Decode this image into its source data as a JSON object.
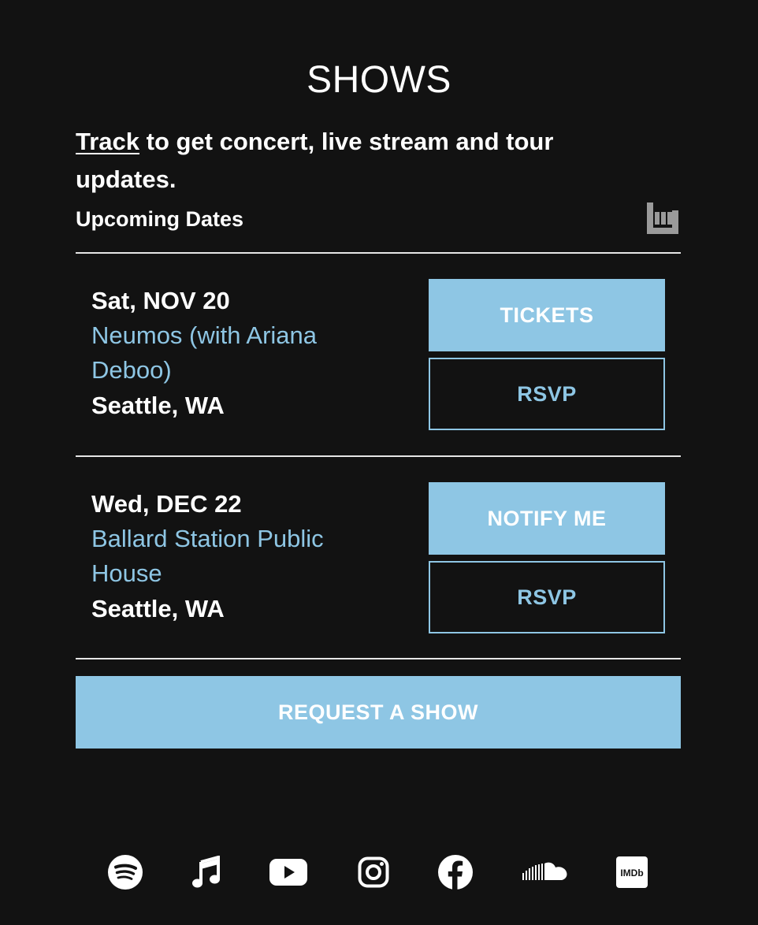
{
  "page": {
    "title": "SHOWS",
    "track_link": "Track",
    "track_text": " to get concert, live stream and tour updates.",
    "upcoming_label": "Upcoming Dates"
  },
  "events": [
    {
      "date": "Sat, NOV 20",
      "venue": "Neumos (with Ariana Deboo)",
      "location": "Seattle, WA",
      "primary_button": "TICKETS",
      "secondary_button": "RSVP"
    },
    {
      "date": "Wed, DEC 22",
      "venue": "Ballard Station Public House",
      "location": "Seattle, WA",
      "primary_button": "NOTIFY ME",
      "secondary_button": "RSVP"
    }
  ],
  "request_button": "REQUEST A SHOW",
  "icons": {
    "bandsintown": "bandsintown-icon",
    "social": [
      "spotify-icon",
      "apple-music-icon",
      "youtube-icon",
      "instagram-icon",
      "facebook-icon",
      "soundcloud-icon",
      "imdb-icon"
    ]
  },
  "colors": {
    "background": "#121212",
    "accent": "#8ec6e4",
    "text": "#ffffff",
    "divider": "#e6e6e6"
  }
}
